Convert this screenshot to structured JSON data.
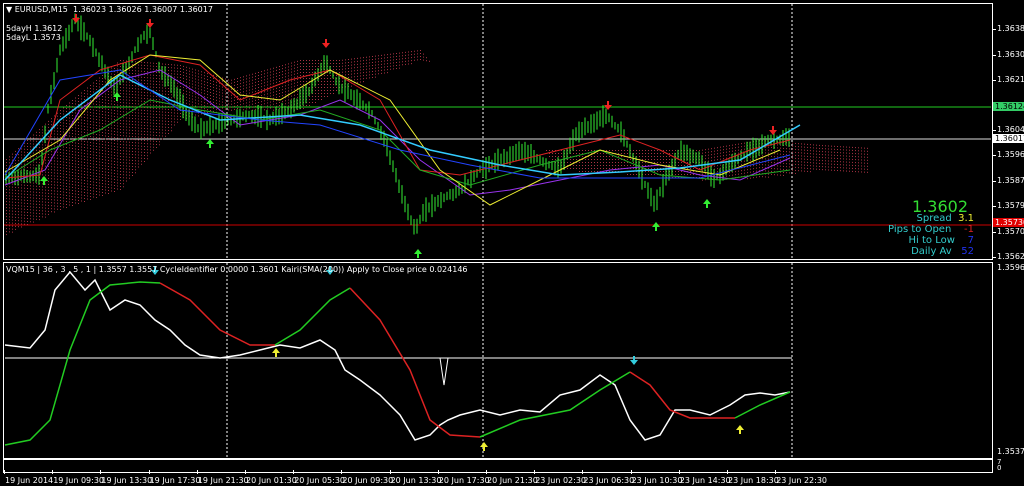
{
  "main": {
    "title": "EURUSD,M15",
    "ohlc": "1.36023 1.36026 1.36007 1.36017",
    "five_day_high": "5dayH 1.3612",
    "five_day_low": "5dayL 1.3573",
    "price_axis": [
      "1.36385",
      "1.36300",
      "1.36215",
      "1.36045",
      "1.35960",
      "1.35875",
      "1.35790",
      "1.35705",
      "1.35620"
    ],
    "badge_green": "1.36124",
    "badge_white": "1.36017",
    "badge_red": "1.35730",
    "colors": {
      "green": "#22cc22",
      "red": "#cc0000",
      "badge_green": "#33cc66"
    }
  },
  "info": {
    "price": "1.3602",
    "spread_label": "Spread",
    "spread_value": "3.1",
    "pips_label": "Pips to Open",
    "pips_value": "-1",
    "hilo_label": "Hi to Low",
    "hilo_value": "7",
    "daily_label": "Daily Av",
    "daily_value": "52"
  },
  "sub": {
    "title": "VQM15 | 36 , 3 , 5 , 1 | 1.3557 1.3557 CycleIdentifier 0.0000 1.3601 Kairi(SMA(200)) Apply to Close price 0.024146",
    "axis_top": "1.3596",
    "axis_bottom": "1.3537",
    "mini_top": "7",
    "mini_bottom": "0"
  },
  "time_axis": [
    "19 Jun 2014",
    "19 Jun 09:30",
    "19 Jun 13:30",
    "19 Jun 17:30",
    "19 Jun 21:30",
    "20 Jun 01:30",
    "20 Jun 05:30",
    "20 Jun 09:30",
    "20 Jun 13:30",
    "20 Jun 17:30",
    "20 Jun 21:30",
    "23 Jun 02:30",
    "23 Jun 06:30",
    "23 Jun 10:30",
    "23 Jun 14:30",
    "23 Jun 18:30",
    "23 Jun 22:30"
  ]
}
